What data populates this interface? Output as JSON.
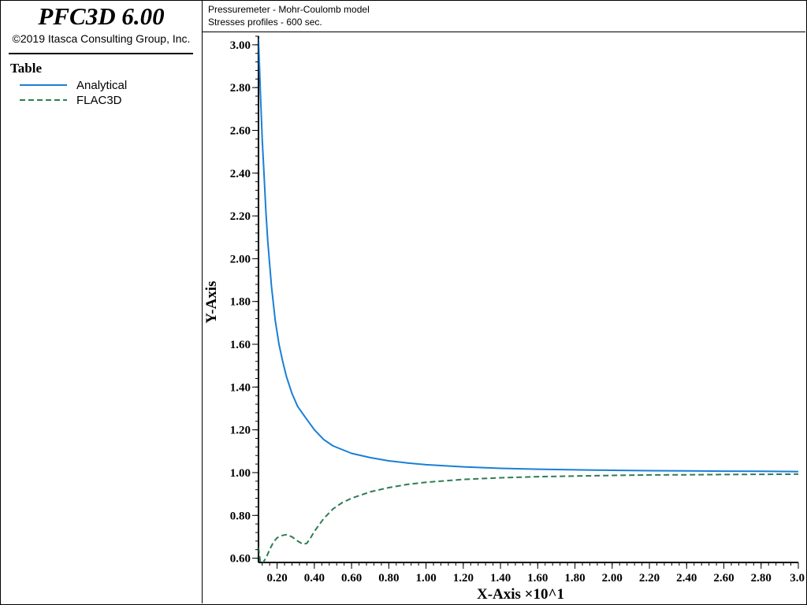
{
  "sidebar": {
    "product": "PFC3D 6.00",
    "copyright": "©2019 Itasca Consulting Group, Inc.",
    "legend_title": "Table",
    "legend": [
      {
        "label": "Analytical",
        "color": "#1a7fd6",
        "style": "solid"
      },
      {
        "label": "FLAC3D",
        "color": "#2e7d55",
        "style": "dashed"
      }
    ]
  },
  "header": {
    "line1": "Pressuremeter - Mohr-Coulomb model",
    "line2": "Stresses profiles - 600 sec."
  },
  "chart_data": {
    "type": "line",
    "title": "Pressuremeter - Mohr-Coulomb model",
    "subtitle": "Stresses profiles - 600 sec.",
    "xlabel": "X-Axis ×10^1",
    "ylabel": "Y-Axis",
    "xlim": [
      0.1,
      3.0
    ],
    "ylim": [
      0.58,
      3.04
    ],
    "x_ticks": [
      0.2,
      0.4,
      0.6,
      0.8,
      1.0,
      1.2,
      1.4,
      1.6,
      1.8,
      2.0,
      2.2,
      2.4,
      2.6,
      2.8,
      3.0
    ],
    "x_tick_labels": [
      "0.20",
      "0.40",
      "0.60",
      "0.80",
      "1.00",
      "1.20",
      "1.40",
      "1.60",
      "1.80",
      "2.00",
      "2.20",
      "2.40",
      "2.60",
      "2.80",
      "3.0"
    ],
    "y_ticks": [
      0.6,
      0.8,
      1.0,
      1.2,
      1.4,
      1.6,
      1.8,
      2.0,
      2.2,
      2.4,
      2.6,
      2.8,
      3.0
    ],
    "y_tick_labels": [
      "0.60",
      "0.80",
      "1.00",
      "1.20",
      "1.40",
      "1.60",
      "1.80",
      "2.00",
      "2.20",
      "2.40",
      "2.60",
      "2.80",
      "3.00"
    ],
    "grid": false,
    "legend_position": "left-panel",
    "series": [
      {
        "name": "Analytical",
        "color": "#1a7fd6",
        "style": "solid",
        "x": [
          0.1,
          0.11,
          0.12,
          0.13,
          0.14,
          0.15,
          0.17,
          0.19,
          0.21,
          0.23,
          0.25,
          0.28,
          0.31,
          0.35,
          0.4,
          0.45,
          0.5,
          0.6,
          0.7,
          0.8,
          0.9,
          1.0,
          1.2,
          1.4,
          1.6,
          1.8,
          2.0,
          2.2,
          2.4,
          2.6,
          2.8,
          3.0
        ],
        "y": [
          3.03,
          2.78,
          2.56,
          2.39,
          2.22,
          2.08,
          1.87,
          1.71,
          1.6,
          1.52,
          1.45,
          1.37,
          1.31,
          1.26,
          1.2,
          1.155,
          1.125,
          1.09,
          1.07,
          1.055,
          1.045,
          1.037,
          1.027,
          1.02,
          1.016,
          1.013,
          1.011,
          1.009,
          1.008,
          1.007,
          1.006,
          1.005
        ]
      },
      {
        "name": "FLAC3D",
        "color": "#2e7d55",
        "style": "dashed",
        "x": [
          0.1,
          0.11,
          0.12,
          0.14,
          0.16,
          0.18,
          0.2,
          0.22,
          0.25,
          0.28,
          0.31,
          0.34,
          0.36,
          0.38,
          0.4,
          0.45,
          0.5,
          0.55,
          0.6,
          0.7,
          0.8,
          0.9,
          1.0,
          1.2,
          1.4,
          1.6,
          1.8,
          2.0,
          2.2,
          2.4,
          2.6,
          2.8,
          3.0
        ],
        "y": [
          0.65,
          0.58,
          0.575,
          0.6,
          0.64,
          0.675,
          0.695,
          0.705,
          0.71,
          0.7,
          0.68,
          0.665,
          0.67,
          0.695,
          0.725,
          0.785,
          0.83,
          0.86,
          0.88,
          0.91,
          0.93,
          0.945,
          0.955,
          0.968,
          0.976,
          0.981,
          0.984,
          0.987,
          0.989,
          0.99,
          0.991,
          0.992,
          0.993
        ]
      }
    ]
  }
}
